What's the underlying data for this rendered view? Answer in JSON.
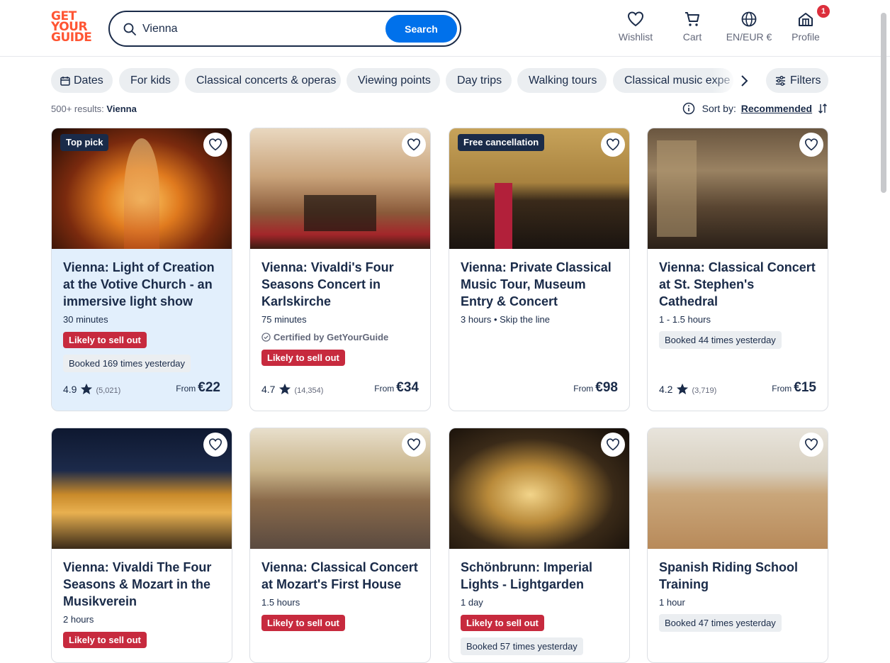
{
  "logo": {
    "line1": "GET",
    "line2": "YOUR",
    "line3": "GUIDE"
  },
  "search": {
    "value": "Vienna",
    "button": "Search"
  },
  "nav": {
    "wishlist": "Wishlist",
    "cart": "Cart",
    "lang": "EN/EUR €",
    "profile": "Profile",
    "profile_badge": "1"
  },
  "chips": [
    "Dates",
    "For kids",
    "Classical concerts & operas",
    "Viewing points",
    "Day trips",
    "Walking tours",
    "Classical music expe"
  ],
  "filters_label": "Filters",
  "results": {
    "count": "500+ results:",
    "query": "Vienna"
  },
  "sort": {
    "label": "Sort by:",
    "value": "Recommended"
  },
  "colors": {
    "accent": "#0071eb",
    "brand": "#ff5533",
    "danger": "#c72a3e",
    "text": "#1a2b49"
  },
  "cards": [
    {
      "tag": "Top pick",
      "title": "Vienna: Light of Creation at the Votive Church - an immersive light show",
      "duration": "30 minutes",
      "sell": "Likely to sell out",
      "booked": "Booked 169 times yesterday",
      "rating": "4.9",
      "reviews": "(5,021)",
      "from": "From",
      "price": "€22"
    },
    {
      "tag": "",
      "title": "Vienna: Vivaldi's Four Seasons Concert in Karlskirche",
      "duration": "75 minutes",
      "certified": "Certified by GetYourGuide",
      "sell": "Likely to sell out",
      "rating": "4.7",
      "reviews": "(14,354)",
      "from": "From",
      "price": "€34"
    },
    {
      "tag": "Free cancellation",
      "title": "Vienna: Private Classical Music Tour, Museum Entry & Concert",
      "duration": "3 hours • Skip the line",
      "from": "From",
      "price": "€98"
    },
    {
      "tag": "",
      "title": "Vienna: Classical Concert at St. Stephen's Cathedral",
      "duration": "1 - 1.5 hours",
      "booked": "Booked 44 times yesterday",
      "rating": "4.2",
      "reviews": "(3,719)",
      "from": "From",
      "price": "€15"
    },
    {
      "title": "Vienna: Vivaldi The Four Seasons & Mozart in the Musikverein",
      "duration": "2 hours",
      "sell": "Likely to sell out"
    },
    {
      "title": "Vienna: Classical Concert at Mozart's First House",
      "duration": "1.5 hours",
      "sell": "Likely to sell out"
    },
    {
      "title": "Schönbrunn: Imperial Lights - Lightgarden",
      "duration": "1 day",
      "sell": "Likely to sell out",
      "booked": "Booked 57 times yesterday"
    },
    {
      "title": "Spanish Riding School Training",
      "duration": "1 hour",
      "booked": "Booked 47 times yesterday"
    }
  ]
}
